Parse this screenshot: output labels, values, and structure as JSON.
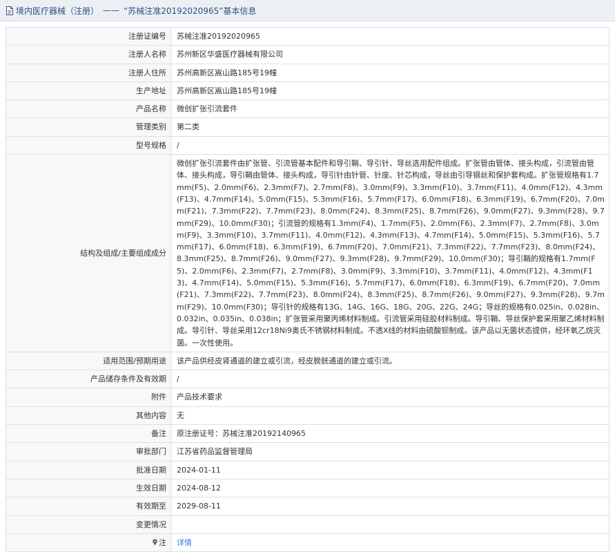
{
  "header": {
    "category": "境内医疗器械（注册）",
    "separator": "——",
    "title": "“苏械注准20192020965”基本信息"
  },
  "rows": [
    {
      "label": "注册证编号",
      "value": "苏械注准20192020965"
    },
    {
      "label": "注册人名称",
      "value": "苏州新区华盛医疗器械有限公司"
    },
    {
      "label": "注册人住所",
      "value": "苏州高新区嵩山路185号19幢"
    },
    {
      "label": "生产地址",
      "value": "苏州高新区嵩山路185号19幢"
    },
    {
      "label": "产品名称",
      "value": "微创扩张引流套件"
    },
    {
      "label": "管理类别",
      "value": "第二类"
    },
    {
      "label": "型号规格",
      "value": "/"
    },
    {
      "label": "结构及组成/主要组成成分",
      "value": "微创扩张引流套件由扩张管、引流管基本配件和导引鞘、导引针、导丝选用配件组成。扩张管由管体、接头构成，引流管由管体、接头构成，导引鞘由管体、接头构成，导引针由针管、针座、针芯构成，导丝由引导钢丝和保护套构成。扩张管规格有1.7mm(F5)、2.0mm(F6)、2.3mm(F7)、2.7mm(F8)、3.0mm(F9)、3.3mm(F10)、3.7mm(F11)、4.0mm(F12)、4.3mm(F13)、4.7mm(F14)、5.0mm(F15)、5.3mm(F16)、5.7mm(F17)、6.0mm(F18)、6.3mm(F19)、6.7mm(F20)、7.0mm(F21)、7.3mm(F22)、7.7mm(F23)、8.0mm(F24)、8.3mm(F25)、8.7mm(F26)、9.0mm(F27)、9.3mm(F28)、9.7mm(F29)、10.0mm(F30)；引流管的规格有1.3mm(F4)、1.7mm(F5)、2.0mm(F6)、2.3mm(F7)、2.7mm(F8)、3.0mm(F9)、3.3mm(F10)、3.7mm(F11)、4.0mm(F12)、4.3mm(F13)、4.7mm(F14)、5.0mm(F15)、5.3mm(F16)、5.7mm(F17)、6.0mm(F18)、6.3mm(F19)、6.7mm(F20)、7.0mm(F21)、7.3mm(F22)、7.7mm(F23)、8.0mm(F24)、8.3mm(F25)、8.7mm(F26)、9.0mm(F27)、9.3mm(F28)、9.7mm(F29)、10.0mm(F30)；导引鞘的规格有1.7mm(F5)、2.0mm(F6)、2.3mm(F7)、2.7mm(F8)、3.0mm(F9)、3.3mm(F10)、3.7mm(F11)、4.0mm(F12)、4.3mm(F13)、4.7mm(F14)、5.0mm(F15)、5.3mm(F16)、5.7mm(F17)、6.0mm(F18)、6.3mm(F19)、6.7mm(F20)、7.0mm(F21)、7.3mm(F22)、7.7mm(F23)、8.0mm(F24)、8.3mm(F25)、8.7mm(F26)、9.0mm(F27)、9.3mm(F28)、9.7mm(F29)、10.0mm(F30)；导引针的规格有13G、14G、16G、18G、20G、22G、24G；导丝的规格有0.025in、0.028in、0.032in、0.035in、0.038in；扩张管采用聚丙烯材料制成。引流管采用硅胶材料制成。导引鞘、导丝保护套采用聚乙烯材料制成。导引针、导丝采用12cr18Ni9奥氏不锈钢材料制成。不透X线的材料由硫酸钡制成。该产品以无菌状态提供，经环氧乙烷灭菌。一次性使用。"
    },
    {
      "label": "适用范围/预期用途",
      "value": "该产品供经皮肾通道的建立或引流，经皮膀胱通道的建立或引流。"
    },
    {
      "label": "产品储存条件及有效期",
      "value": "/"
    },
    {
      "label": "附件",
      "value": "产品技术要求"
    },
    {
      "label": "其他内容",
      "value": "无"
    },
    {
      "label": "备注",
      "value": "原注册证号：苏械注准20192140965"
    },
    {
      "label": "审批部门",
      "value": "江苏省药品监督管理局"
    },
    {
      "label": "批准日期",
      "value": "2024-01-11"
    },
    {
      "label": "生效日期",
      "value": "2024-08-12"
    },
    {
      "label": "有效期至",
      "value": "2029-08-11"
    },
    {
      "label": "变更情况",
      "value": ""
    }
  ],
  "note": {
    "label": "注",
    "link_text": "详情",
    "icon": "pin-icon"
  },
  "colors": {
    "header_bg": "#ecf0f5",
    "label_bg": "#f7f8fa",
    "border": "#dcdfe6",
    "link": "#3a7bd5",
    "header_text": "#2f4f7f"
  }
}
